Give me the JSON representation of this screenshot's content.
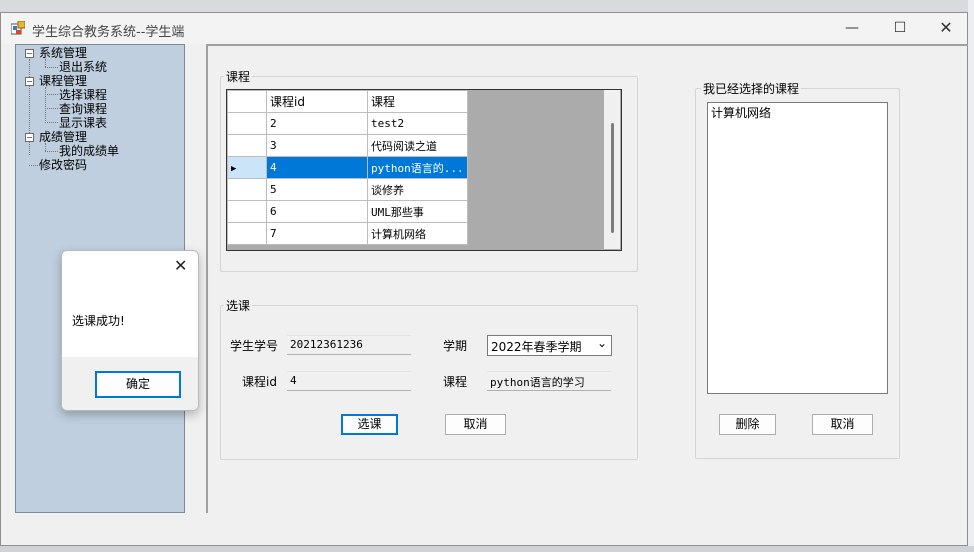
{
  "window": {
    "title": "学生综合教务系统--学生端"
  },
  "title_controls": {
    "minimize": "—",
    "maximize": "☐",
    "close": "✕"
  },
  "tree": [
    {
      "label": "系统管理",
      "children": [
        "退出系统"
      ]
    },
    {
      "label": "课程管理",
      "children": [
        "选择课程",
        "查询课程",
        "显示课表"
      ]
    },
    {
      "label": "成绩管理",
      "children": [
        "我的成绩单"
      ]
    },
    {
      "label": "修改密码",
      "children": []
    }
  ],
  "tree_expander": "−",
  "courses_group": {
    "title": "课程",
    "columns": [
      "课程id",
      "课程"
    ],
    "rows": [
      {
        "id": "2",
        "name": "test2"
      },
      {
        "id": "3",
        "name": "代码阅读之道"
      },
      {
        "id": "4",
        "name": "python语言的..."
      },
      {
        "id": "5",
        "name": "谈修养"
      },
      {
        "id": "6",
        "name": "UML那些事"
      },
      {
        "id": "7",
        "name": "计算机网络"
      }
    ],
    "selected_marker": "▶"
  },
  "select_group": {
    "title": "选课",
    "student_id_label": "学生学号",
    "student_id_value": "20212361236",
    "semester_label": "学期",
    "semester_value": "2022年春季学期",
    "course_id_label": "课程id",
    "course_id_value": "4",
    "course_label": "课程",
    "course_value": "python语言的学习",
    "select_button": "选课",
    "cancel_button": "取消",
    "combo_arrow": "⌄"
  },
  "chosen_group": {
    "title": "我已经选择的课程",
    "items": [
      "计算机网络"
    ],
    "delete_button": "删除",
    "cancel_button": "取消"
  },
  "dialog": {
    "message": "选课成功!",
    "ok_button": "确定",
    "close": "✕"
  },
  "colors": {
    "selection": "#0078d7",
    "tree_bg": "#bfcfdf"
  }
}
